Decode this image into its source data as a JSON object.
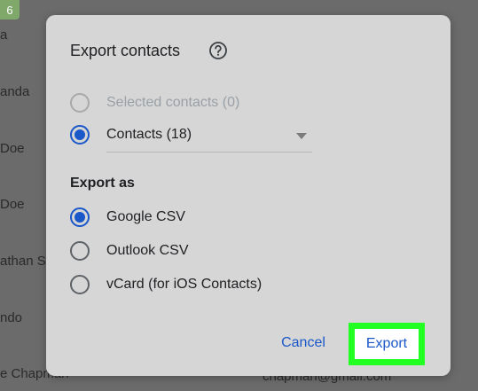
{
  "background": {
    "badge": "6",
    "contacts": [
      "a",
      "anda",
      "Doe",
      "Doe",
      "athan S",
      "ndo",
      "e Chapman"
    ],
    "email_fragment": "chapman@gmail.com"
  },
  "dialog": {
    "title": "Export contacts",
    "help_icon": "help-circle-icon",
    "scope_options": [
      {
        "label": "Selected contacts (0)",
        "state": "disabled"
      },
      {
        "label": "Contacts (18)",
        "state": "selected"
      }
    ],
    "export_as_heading": "Export as",
    "format_options": [
      {
        "label": "Google CSV",
        "state": "selected"
      },
      {
        "label": "Outlook CSV",
        "state": "unselected"
      },
      {
        "label": "vCard (for iOS Contacts)",
        "state": "unselected"
      }
    ],
    "cancel_label": "Cancel",
    "export_label": "Export"
  },
  "colors": {
    "accent": "#1a57c9",
    "highlight": "#22ff22",
    "dialog_bg": "#d6d6d6",
    "overlay_bg": "#6b6b6b"
  }
}
